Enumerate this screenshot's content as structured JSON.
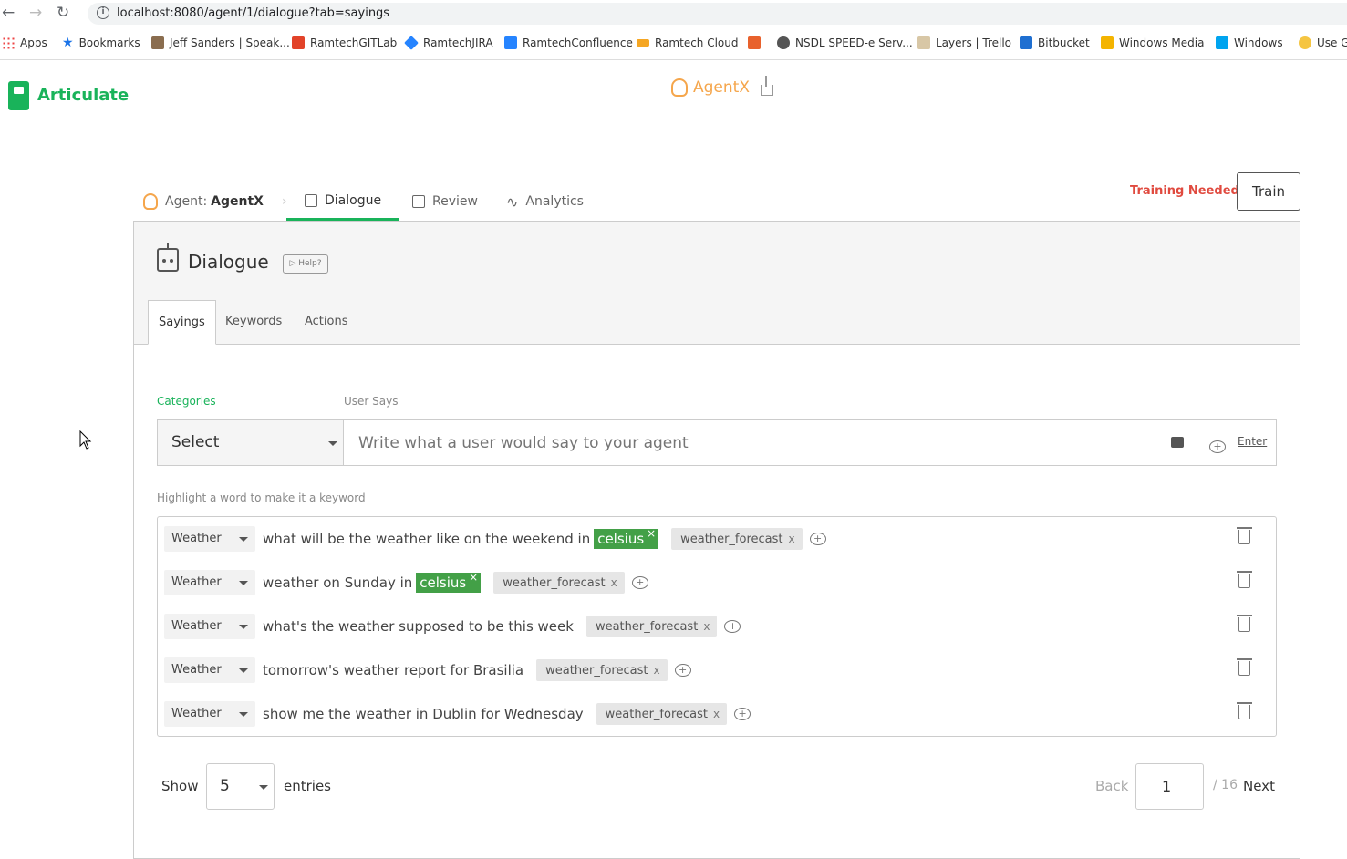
{
  "browser": {
    "url": "localhost:8080/agent/1/dialogue?tab=sayings",
    "bookmarks": [
      "Apps",
      "Bookmarks",
      "Jeff Sanders | Speak...",
      "RamtechGITLab",
      "RamtechJIRA",
      "RamtechConfluence",
      "Ramtech Cloud",
      "",
      "NSDL SPEED-e Serv...",
      "Layers | Trello",
      "Bitbucket",
      "Windows Media",
      "Windows",
      "Use G"
    ]
  },
  "app": {
    "logo": "Articulate",
    "agent_name": "AgentX"
  },
  "nav": {
    "agent_label": "Agent:",
    "agent_value": "AgentX",
    "tabs": [
      "Dialogue",
      "Review",
      "Analytics"
    ],
    "status": "Training Needed",
    "train_button": "Train"
  },
  "panel": {
    "title": "Dialogue",
    "help": "▷ Help?",
    "subtabs": [
      "Sayings",
      "Keywords",
      "Actions"
    ],
    "categories_label": "Categories",
    "user_says_label": "User Says",
    "category_select": "Select",
    "input_placeholder": "Write what a user would say to your agent",
    "enter_label": "Enter",
    "hint": "Highlight a word to make it a keyword"
  },
  "sayings": [
    {
      "category": "Weather",
      "pre": "what will be the weather like on the weekend in",
      "keyword": "celsius",
      "intent": "weather_forecast"
    },
    {
      "category": "Weather",
      "pre": "weather on Sunday in",
      "keyword": "celsius",
      "intent": "weather_forecast"
    },
    {
      "category": "Weather",
      "pre": "what's the weather supposed to be this week",
      "keyword": "",
      "intent": "weather_forecast"
    },
    {
      "category": "Weather",
      "pre": "tomorrow's weather report for Brasilia",
      "keyword": "",
      "intent": "weather_forecast"
    },
    {
      "category": "Weather",
      "pre": "show me the weather in Dublin for Wednesday",
      "keyword": "",
      "intent": "weather_forecast"
    }
  ],
  "pagination": {
    "show_label": "Show",
    "page_size": "5",
    "entries_label": "entries",
    "back": "Back",
    "page": "1",
    "total": "/ 16",
    "next": "Next"
  },
  "colors": {
    "brand": "#19b35a",
    "accent": "#f5a64c",
    "warning": "#e04a3f",
    "keyword": "#43a047"
  }
}
